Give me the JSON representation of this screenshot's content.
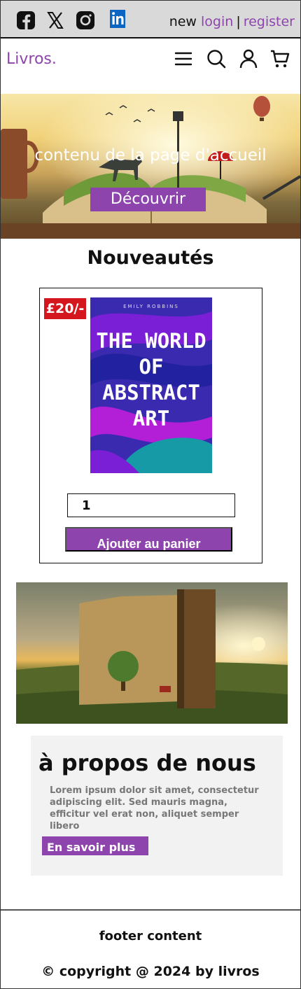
{
  "topbar": {
    "social_icons": [
      "facebook-icon",
      "x-icon",
      "instagram-icon",
      "linkedin-icon"
    ],
    "new_label": "new",
    "login_label": "login",
    "separator": "|",
    "register_label": "register"
  },
  "nav": {
    "logo": "Livros.",
    "icons": [
      "menu-icon",
      "search-icon",
      "user-icon",
      "cart-icon"
    ]
  },
  "hero": {
    "title": "contenu de la page d'accueil",
    "button_label": "Découvrir"
  },
  "new_releases": {
    "title": "Nouveautés",
    "product": {
      "price": "£20/-",
      "cover_author": "EMILY ROBBINS",
      "cover_title": "THE WORLD OF ABSTRACT ART",
      "quantity": "1",
      "add_to_cart_label": "Ajouter au panier"
    }
  },
  "about": {
    "title": "à propos de nous",
    "text": "Lorem ipsum dolor sit amet, consectetur adipiscing elit. Sed mauris magna, efficitur vel erat non, aliquet semper libero",
    "button_label": "En savoir plus"
  },
  "footer": {
    "content": "footer content",
    "copyright": "© copyright @ 2024 by livros"
  },
  "colors": {
    "accent": "#8e44ad",
    "price_badge": "#d4161e",
    "topbar_bg": "#d9d9d9"
  }
}
